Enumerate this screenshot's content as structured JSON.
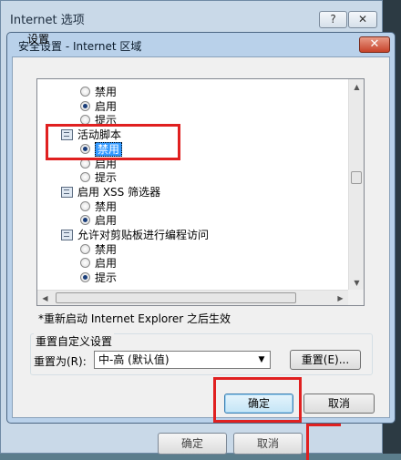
{
  "outer_window": {
    "title": "Internet 选项",
    "help_label": "?",
    "close_label": "✕",
    "ok_label": "确定",
    "cancel_label": "取消"
  },
  "dialog": {
    "title": "安全设置 - Internet 区域",
    "close_label": "✕",
    "settings_label": "设置",
    "list": [
      {
        "type": "option",
        "label": "禁用",
        "selected": false
      },
      {
        "type": "option",
        "label": "启用",
        "selected": true
      },
      {
        "type": "option",
        "label": "提示",
        "selected": false
      },
      {
        "type": "category",
        "label": "活动脚本"
      },
      {
        "type": "option",
        "label": "禁用",
        "selected": true,
        "highlighted": true
      },
      {
        "type": "option",
        "label": "启用",
        "selected": false
      },
      {
        "type": "option",
        "label": "提示",
        "selected": false
      },
      {
        "type": "category",
        "label": "启用 XSS 筛选器"
      },
      {
        "type": "option",
        "label": "禁用",
        "selected": false
      },
      {
        "type": "option",
        "label": "启用",
        "selected": true
      },
      {
        "type": "category",
        "label": "允许对剪贴板进行编程访问"
      },
      {
        "type": "option",
        "label": "禁用",
        "selected": false
      },
      {
        "type": "option",
        "label": "启用",
        "selected": false
      },
      {
        "type": "option",
        "label": "提示",
        "selected": true
      }
    ],
    "restart_note": "*重新启动 Internet Explorer 之后生效",
    "reset_group_title": "重置自定义设置",
    "reset_to_label": "重置为(R):",
    "reset_select_value": "中-高 (默认值)",
    "reset_button_label": "重置(E)...",
    "ok_label": "确定",
    "cancel_label": "取消"
  },
  "colors": {
    "dialog_frame": "#b9d1ea",
    "highlight": "#3399ff",
    "annotation_red": "#e02020"
  }
}
